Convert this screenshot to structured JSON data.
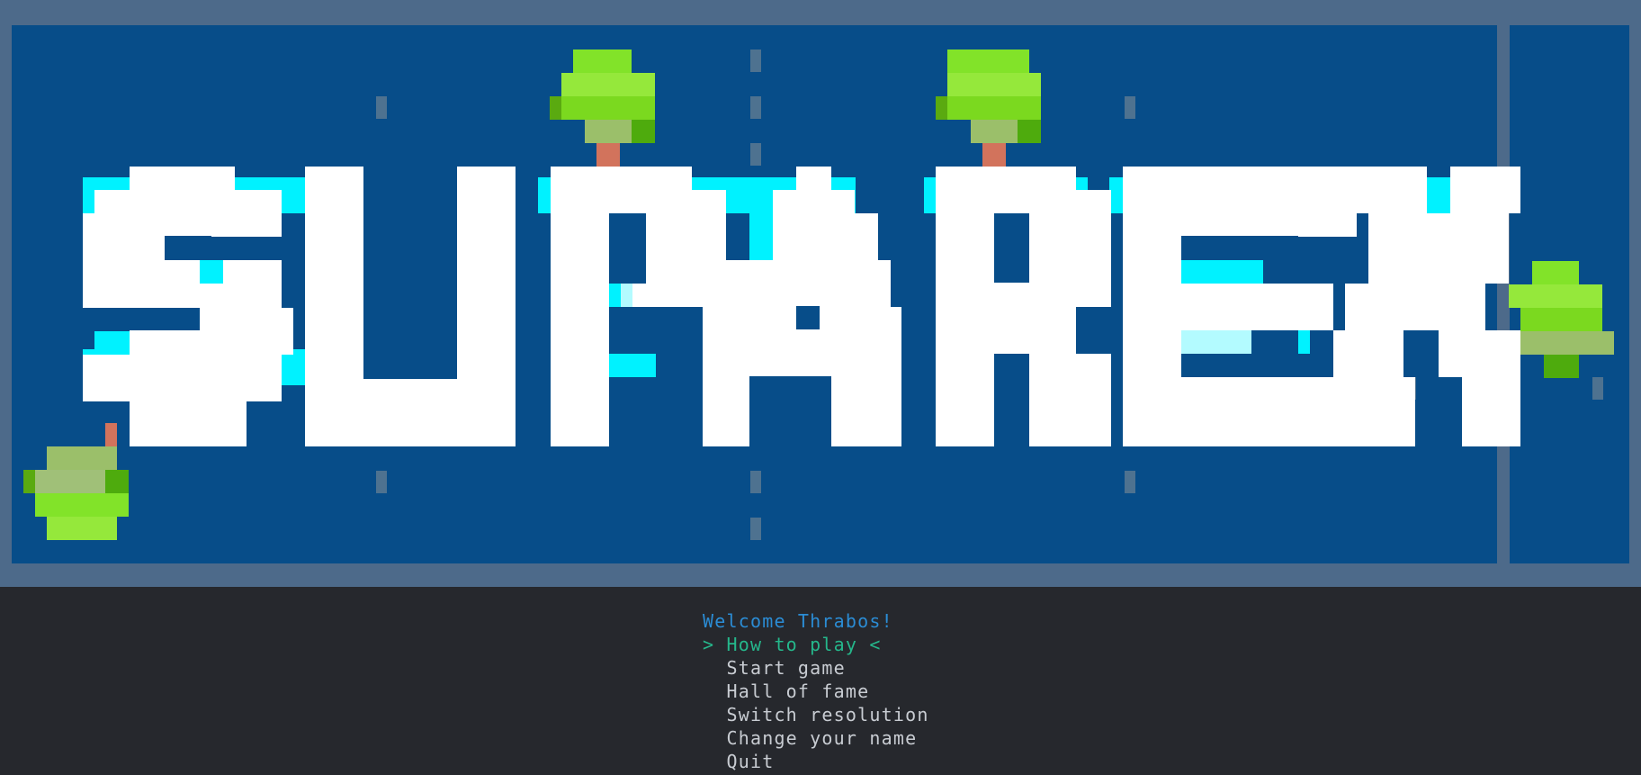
{
  "title_logo": {
    "text": "SUPAREX"
  },
  "colors": {
    "frame": "#4d6a8a",
    "field": "#074d89",
    "logo_fill": "#ffffff",
    "logo_glow": "#00f2ff",
    "logo_shadow": "#0f8c95",
    "lane_marker": "#4e7290",
    "tree_leaf": "#82e329",
    "tree_trunk": "#d2735c",
    "background": "#26282d",
    "welcome_text": "#2b8cd4",
    "menu_selected": "#25b78b",
    "menu_text": "#c8ccd2"
  },
  "welcome": {
    "text": "Welcome Thrabos!"
  },
  "menu": {
    "items": [
      {
        "label": "> How to play <",
        "selected": true
      },
      {
        "label": "  Start game",
        "selected": false
      },
      {
        "label": "  Hall of fame",
        "selected": false
      },
      {
        "label": "  Switch resolution",
        "selected": false
      },
      {
        "label": "  Change your name",
        "selected": false
      },
      {
        "label": "  Quit",
        "selected": false
      }
    ]
  }
}
